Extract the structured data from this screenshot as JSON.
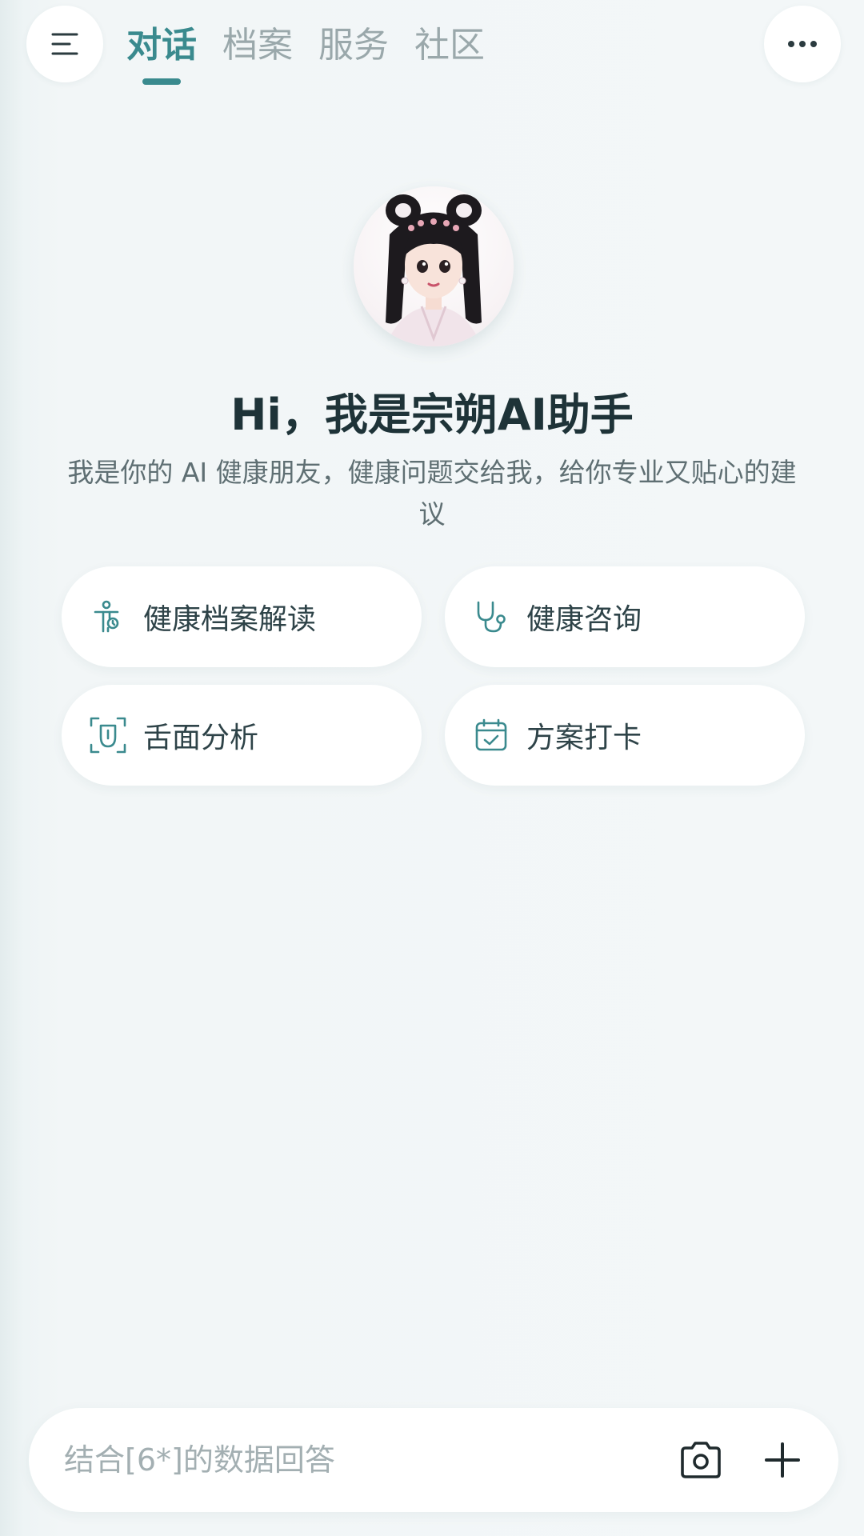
{
  "header": {
    "menu_icon": "menu-icon",
    "more_icon": "more-icon",
    "tabs": [
      {
        "label": "对话",
        "active": true
      },
      {
        "label": "档案",
        "active": false
      },
      {
        "label": "服务",
        "active": false
      },
      {
        "label": "社区",
        "active": false
      }
    ]
  },
  "assistant": {
    "greeting": "Hi，我是宗朔AI助手",
    "subtitle": "我是你的 AI 健康朋友，健康问题交给我，给你专业又贴心的建议"
  },
  "actions": [
    {
      "label": "健康档案解读",
      "icon": "body-figure-icon"
    },
    {
      "label": "健康咨询",
      "icon": "stethoscope-icon"
    },
    {
      "label": "舌面分析",
      "icon": "face-scan-icon"
    },
    {
      "label": "方案打卡",
      "icon": "calendar-check-icon"
    }
  ],
  "input": {
    "placeholder": "结合[6*]的数据回答",
    "camera_icon": "camera-icon",
    "plus_icon": "plus-icon"
  },
  "colors": {
    "accent": "#3a8a8e",
    "background": "#f3f7f8",
    "text": "#1e3338",
    "muted": "#9aa8ab"
  }
}
